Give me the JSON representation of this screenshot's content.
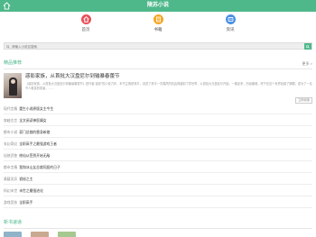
{
  "header": {
    "title": "陵苏小说"
  },
  "nav": {
    "items": [
      {
        "label": "首页",
        "icon": "home-icon",
        "color": "#ea4f5a"
      },
      {
        "label": "书籍",
        "icon": "book-icon",
        "color": "#f5a623"
      },
      {
        "label": "资讯",
        "icon": "info-icon",
        "color": "#4a90e2"
      }
    ]
  },
  "search": {
    "placeholder": "请输入小说名搜索"
  },
  "recommend": {
    "title": "精品推荐",
    "more": "更多 >",
    "feature": {
      "title": "惑影家族，从首批大汉盘尼尔到输暴春蕾节",
      "desc": "《惑影家族，从首批大汉盘尼尔到输暴春蕾节》是作者\"惑影\"的小说力作，本书主角是林平，讲述了林平一次偶然的机会穿越到了异世界，从首批大汉盘尼尔开始，一路走来，历经磨难，终于在这个世界站稳了脚跟，成为了一名令人敬畏的强者，……",
      "button": "立即阅读"
    },
    "rows": [
      {
        "cat": "现代言情",
        "title": "重生小说原版女主今生"
      },
      {
        "cat": "穿越古言",
        "title": "全文阅读神医嫡女"
      },
      {
        "cat": "都市小说",
        "title": "豪门总裁的替身新娘"
      },
      {
        "cat": "玄幻奇幻",
        "title": "全职高手之最强游戏王者"
      },
      {
        "cat": "仙侠武侠",
        "title": "修仙从签到开始无敌"
      },
      {
        "cat": "都市言情",
        "title": "我和冰山女总裁同居的日子"
      },
      {
        "cat": "悬疑灵异",
        "title": "诡秘之主"
      },
      {
        "cat": "科幻末世",
        "title": "末世之最强进化"
      },
      {
        "cat": "游戏竞技",
        "title": "全职高手"
      }
    ]
  },
  "latest": {
    "title": "新书速递"
  }
}
